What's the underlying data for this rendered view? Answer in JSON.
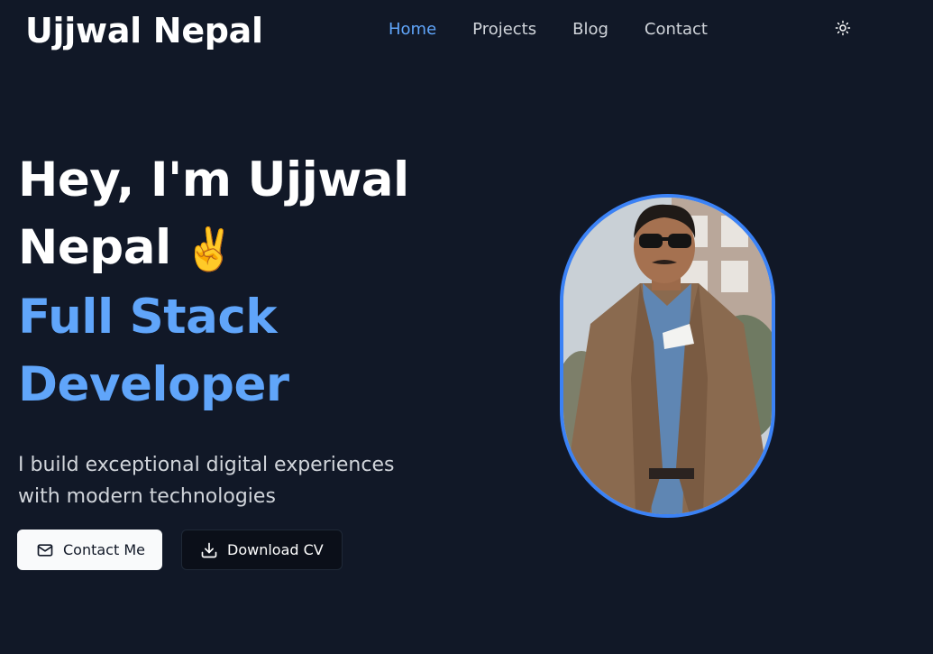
{
  "header": {
    "brand": "Ujjwal Nepal",
    "nav": [
      {
        "label": "Home",
        "active": true
      },
      {
        "label": "Projects",
        "active": false
      },
      {
        "label": "Blog",
        "active": false
      },
      {
        "label": "Contact",
        "active": false
      }
    ],
    "theme_toggle_icon": "sun-icon"
  },
  "hero": {
    "greeting": "Hey, I'm Ujjwal Nepal",
    "greeting_emoji": "✌️",
    "role": "Full Stack Developer",
    "tagline": "I build exceptional digital experiences with modern technologies",
    "buttons": {
      "contact": {
        "label": "Contact Me",
        "icon": "mail-icon"
      },
      "download": {
        "label": "Download CV",
        "icon": "download-icon"
      }
    }
  },
  "colors": {
    "background": "#111827",
    "accent": "#60a5fa",
    "portrait_border": "#3b82f6"
  }
}
